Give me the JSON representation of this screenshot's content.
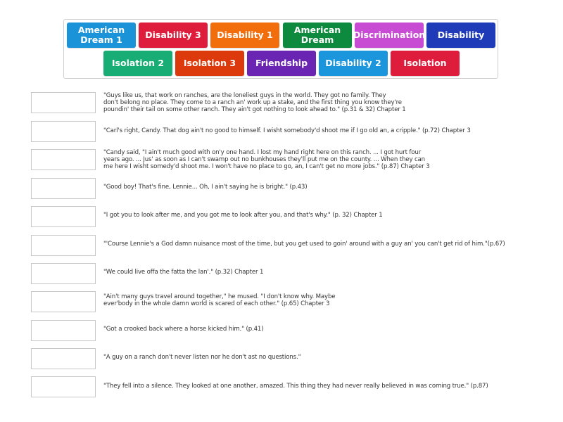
{
  "tiles": [
    {
      "label": "American Dream 1",
      "color": "#1b93d9"
    },
    {
      "label": "Disability 3",
      "color": "#de1d3c"
    },
    {
      "label": "Disability 1",
      "color": "#f26e0d"
    },
    {
      "label": "American Dream",
      "color": "#0e8a3e"
    },
    {
      "label": "Discrimination",
      "color": "#c84bd3"
    },
    {
      "label": "Disability",
      "color": "#1f3bb8"
    },
    {
      "label": "Isolation 2",
      "color": "#17ad74"
    },
    {
      "label": "Isolation 3",
      "color": "#dc3a0c"
    },
    {
      "label": "Friendship",
      "color": "#6a25b2"
    },
    {
      "label": "Disability 2",
      "color": "#1b96dc"
    },
    {
      "label": "Isolation",
      "color": "#de1d3c"
    }
  ],
  "quotes": [
    "\"Guys like us, that work on ranches, are the loneliest guys in the world. They got no family. They\ndon't belong no place. They come to a ranch an' work up a stake, and the first thing you know they're\npoundin' their tail on some other ranch. They ain't got nothing to look ahead to.\" (p.31 & 32) Chapter 1",
    "\"Carl's right, Candy. That dog ain't no good to himself. I wisht somebody'd shoot me if I go old an, a cripple.\" (p.72) Chapter 3",
    "\"Candy said, \"I ain't much good with on'y one hand. I lost my hand right here on this ranch. ... I got hurt four\nyears ago. ... Jus' as soon as I can't swamp out no bunkhouses they'll put me on the county. ... When they can\nme here I wisht somedy'd shoot me. I won't have no place to go, an, I can't get no more jobs.\" (p.87) Chapter 3",
    "\"Good boy! That's fine, Lennie... Oh, I ain't saying he is bright.\" (p.43)",
    "\"I got you to look after me, and you got me to look after you, and that's why.\" (p. 32) Chapter 1",
    "\"'Course Lennie's a God damn nuisance most of the time, but you get used to goin' around with a guy an' you can't get rid of him.\"(p.67)",
    "\"We could live offa the fatta the lan'.\" (p.32) Chapter 1",
    "\"Ain't many guys travel around together,\" he mused. \"I don't know why. Maybe\never'body in the whole damn world is scared of each other.\" (p.65) Chapter 3",
    "\"Got a crooked back where a horse kicked him.\" (p.41)",
    "\"A guy on a ranch don't never listen nor he don't ast no questions.\"",
    "\"They fell into a silence. They looked at one another, amazed. This thing they had never really believed in was coming true.\" (p.87)"
  ]
}
